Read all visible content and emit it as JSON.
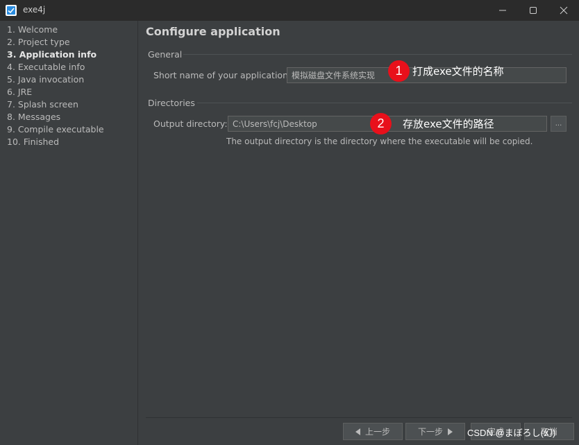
{
  "window": {
    "title": "exe4j",
    "icon": "exe4j-app-icon",
    "controls": [
      "minimize-icon",
      "maximize-icon",
      "close-icon"
    ]
  },
  "sidebar": {
    "steps": [
      {
        "label": "1. Welcome",
        "active": false
      },
      {
        "label": "2. Project type",
        "active": false
      },
      {
        "label": "3. Application info",
        "active": true
      },
      {
        "label": "4. Executable info",
        "active": false
      },
      {
        "label": "5. Java invocation",
        "active": false
      },
      {
        "label": "6. JRE",
        "active": false
      },
      {
        "label": "7. Splash screen",
        "active": false
      },
      {
        "label": "8. Messages",
        "active": false
      },
      {
        "label": "9. Compile executable",
        "active": false
      },
      {
        "label": "10. Finished",
        "active": false
      }
    ]
  },
  "main": {
    "title": "Configure application",
    "general": {
      "label": "General",
      "short_name_label": "Short name of your application:",
      "short_name_value": "模拟磁盘文件系统实现"
    },
    "directories": {
      "label": "Directories",
      "output_label": "Output directory:",
      "output_value": "C:\\Users\\fcj\\Desktop",
      "browse_label": "...",
      "hint": "The output directory is the directory where the executable will be copied."
    }
  },
  "annotations": [
    {
      "number": "1",
      "text": "打成exe文件的名称"
    },
    {
      "number": "2",
      "text": "存放exe文件的路径"
    }
  ],
  "buttons": {
    "back": "上一步",
    "next": "下一步",
    "finish": "完成",
    "cancel": "取消"
  },
  "watermark": "CSDN @まぼろし(幻)",
  "colors": {
    "background": "#3c3f41",
    "titlebar": "#2b2b2b",
    "badge": "#e8101b",
    "accent": "#2a8ce0"
  }
}
